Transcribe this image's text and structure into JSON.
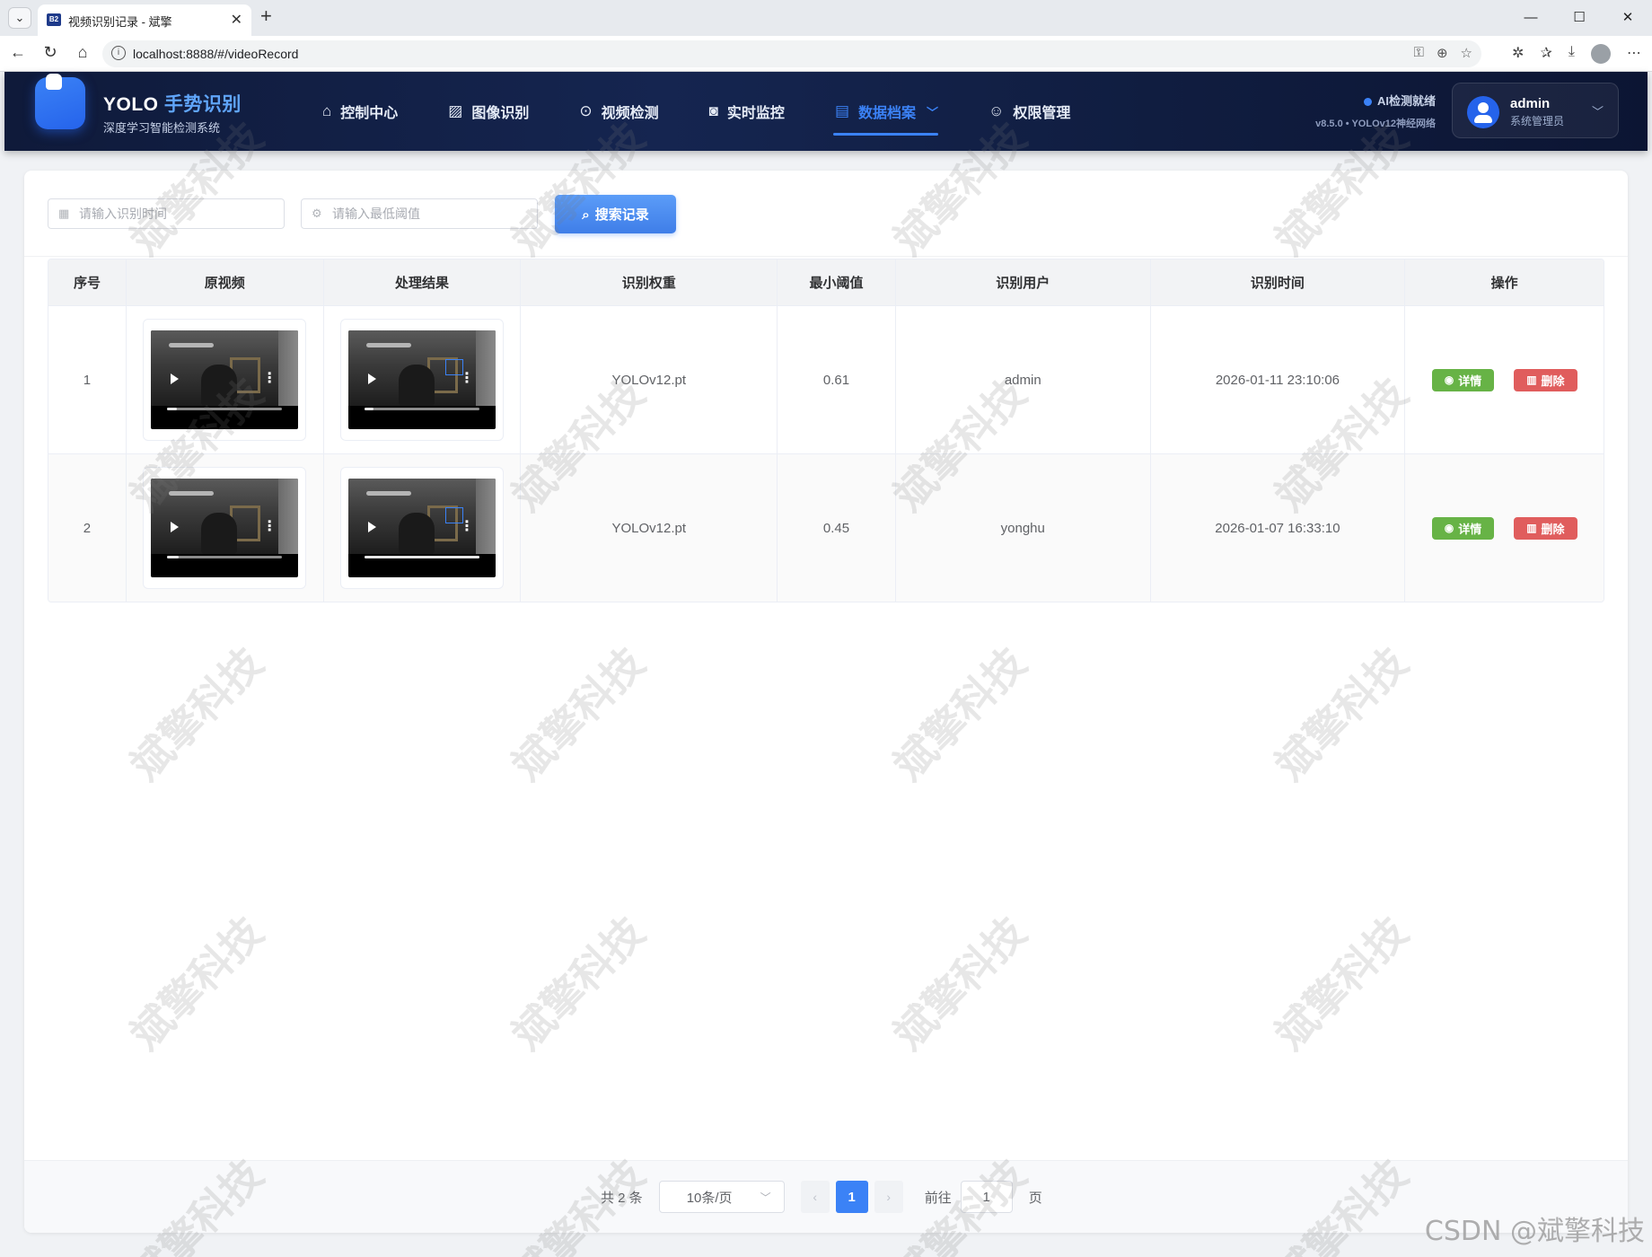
{
  "browser": {
    "tab_favicon": "B2",
    "tab_title": "视频识别记录 - 斌擎",
    "url": "localhost:8888/#/videoRecord"
  },
  "header": {
    "brand_prefix": "YOLO ",
    "brand_accent": "手势识别",
    "brand_subtitle": "深度学习智能检测系统",
    "nav": [
      {
        "label": "控制中心",
        "icon": "home-icon"
      },
      {
        "label": "图像识别",
        "icon": "image-icon"
      },
      {
        "label": "视频检测",
        "icon": "play-circle-icon"
      },
      {
        "label": "实时监控",
        "icon": "camera-icon"
      },
      {
        "label": "数据档案",
        "icon": "document-icon",
        "active": true
      },
      {
        "label": "权限管理",
        "icon": "user-icon"
      }
    ],
    "status_text": "AI检测就绪",
    "version_text": "v8.5.0 • YOLOv12神经网络",
    "user_name": "admin",
    "user_role": "系统管理员"
  },
  "search": {
    "time_placeholder": "请输入识别时间",
    "threshold_placeholder": "请输入最低阈值",
    "button_label": "搜索记录"
  },
  "table": {
    "columns": [
      "序号",
      "原视频",
      "处理结果",
      "识别权重",
      "最小阈值",
      "识别用户",
      "识别时间",
      "操作"
    ],
    "rows": [
      {
        "index": "1",
        "weight": "YOLOv12.pt",
        "threshold": "0.61",
        "user": "admin",
        "time": "2026-01-11 23:10:06",
        "orig_progress": 0.08,
        "result_progress": 0.08
      },
      {
        "index": "2",
        "weight": "YOLOv12.pt",
        "threshold": "0.45",
        "user": "yonghu",
        "time": "2026-01-07 16:33:10",
        "orig_progress": 0.1,
        "result_progress": 1.0
      }
    ],
    "detail_label": "详情",
    "delete_label": "删除"
  },
  "pagination": {
    "total_text": "共 2 条",
    "page_size": "10条/页",
    "current_page": "1",
    "goto_label": "前往",
    "goto_value": "1",
    "page_suffix": "页"
  },
  "watermark": {
    "text": "斌擎科技",
    "csdn": "CSDN @斌擎科技"
  },
  "colors": {
    "accent": "#3b82f6",
    "header_bg": "#152550",
    "detail_green": "#67b346",
    "delete_red": "#e05d5d"
  }
}
